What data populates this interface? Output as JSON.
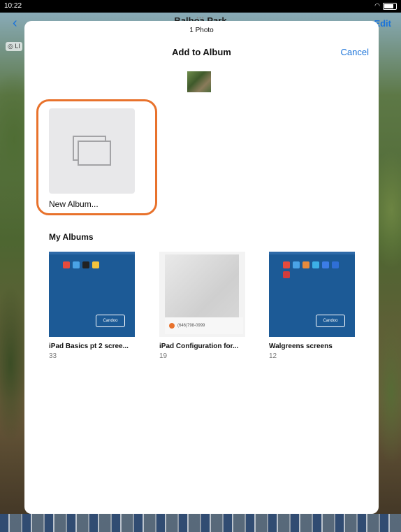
{
  "status_bar": {
    "time": "10:22"
  },
  "background_nav": {
    "title": "Balboa Park",
    "back_glyph": "‹",
    "edit_label": "Edit",
    "live_badge": "◎ LI"
  },
  "sheet": {
    "photo_count": "1 Photo",
    "title": "Add to Album",
    "cancel_label": "Cancel",
    "new_album_label": "New Album...",
    "section_title": "My Albums",
    "albums": [
      {
        "name": "iPad Basics pt 2 scree...",
        "count": "33",
        "cover_style": "blue",
        "cover_text": "Candoo"
      },
      {
        "name": "iPad Configuration for...",
        "count": "19",
        "cover_style": "gray",
        "cover_text": "(646)798-0999"
      },
      {
        "name": "Walgreens screens",
        "count": "12",
        "cover_style": "blue",
        "cover_text": "Candoo"
      }
    ]
  },
  "colors": {
    "accent": "#1a73d9",
    "highlight": "#e8722c",
    "album_blue": "#1c5a96",
    "new_album_bg": "#e8e8ea"
  },
  "icons": [
    "back-chevron-icon",
    "share-icon",
    "heart-icon",
    "trash-icon",
    "wifi-icon",
    "battery-icon",
    "stack-icon"
  ]
}
